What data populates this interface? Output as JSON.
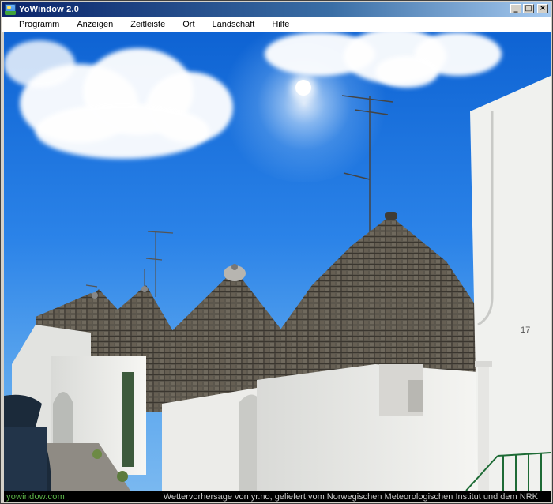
{
  "window": {
    "title": "YoWindow 2.0"
  },
  "window_buttons": {
    "minimize": "_",
    "maximize": "□",
    "close": "×"
  },
  "menu": {
    "items": [
      "Programm",
      "Anzeigen",
      "Zeitleiste",
      "Ort",
      "Landschaft",
      "Hilfe"
    ]
  },
  "scene": {
    "house_number": "17"
  },
  "status": {
    "link": "yowindow.com",
    "credit": "Wettervorhersage von yr.no, geliefert vom Norwegischen Meteorologischen Institut und dem NRK"
  },
  "colors": {
    "sky_top": "#0e63d3",
    "sky_bottom": "#79b8f0",
    "roof": "#5e5a50",
    "wall": "#f2f2ef",
    "status_link": "#5bb548"
  }
}
